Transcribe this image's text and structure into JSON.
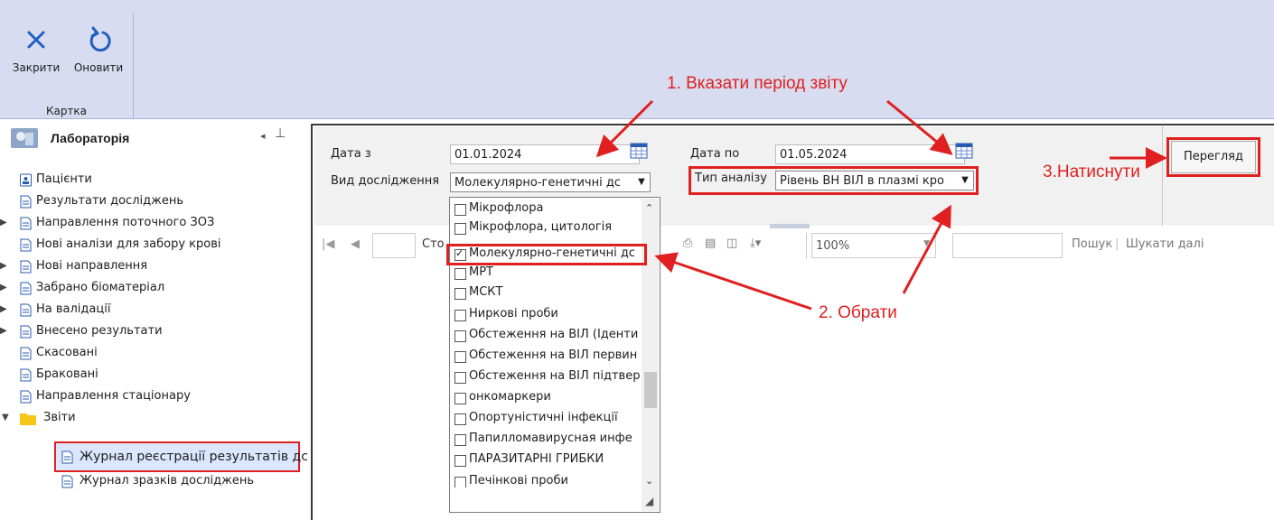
{
  "ribbon": {
    "close_label": "Закрити",
    "refresh_label": "Оновити",
    "group_label": "Картка"
  },
  "sidebar": {
    "title": "Лабораторія",
    "items": [
      {
        "label": "Пацієнти"
      },
      {
        "label": "Результати досліджень"
      },
      {
        "label": "Направлення поточного ЗОЗ"
      },
      {
        "label": "Нові аналізи для забору крові"
      },
      {
        "label": "Нові направлення"
      },
      {
        "label": "Забрано біоматеріал"
      },
      {
        "label": "На валідації"
      },
      {
        "label": "Внесено результати"
      },
      {
        "label": "Скасовані"
      },
      {
        "label": "Браковані"
      },
      {
        "label": "Направлення стаціонару"
      },
      {
        "label": "Звіти"
      },
      {
        "label": "Журнал реєстрації результатів дс"
      },
      {
        "label": "Журнал зразків досліджень"
      }
    ]
  },
  "filters": {
    "date_from_label": "Дата з",
    "date_from_value": "01.01.2024",
    "date_to_label": "Дата по",
    "date_to_value": "01.05.2024",
    "study_type_label": "Вид дослідження",
    "study_type_value": "Молекулярно-генетичні дс",
    "analysis_type_label": "Тип аналізу",
    "analysis_type_value": "Рівень ВН ВІЛ в плазмі кро",
    "view_button": "Перегляд"
  },
  "toolbar": {
    "page_label": "Сто",
    "zoom": "100%",
    "search": "Пошук",
    "search_next": "Шукати далі"
  },
  "dropdown": {
    "items": [
      {
        "label": "Мікрофлора",
        "checked": false
      },
      {
        "label": "Мікрофлора, цитологія",
        "checked": false
      },
      {
        "label": "Молекулярно-генетичні дс",
        "checked": true
      },
      {
        "label": "МРТ",
        "checked": false
      },
      {
        "label": "МСКТ",
        "checked": false
      },
      {
        "label": "Ниркові проби",
        "checked": false
      },
      {
        "label": "Обстеження на ВІЛ (Іденти",
        "checked": false
      },
      {
        "label": "Обстеження на ВІЛ первин",
        "checked": false
      },
      {
        "label": "Обстеження на ВІЛ підтвер",
        "checked": false
      },
      {
        "label": "онкомаркери",
        "checked": false
      },
      {
        "label": "Опортуністичні інфекції",
        "checked": false
      },
      {
        "label": "Папилломавирусная инфе",
        "checked": false
      },
      {
        "label": "ПАРАЗИТАРНІ ГРИБКИ",
        "checked": false
      },
      {
        "label": "Печінкові проби",
        "checked": false
      }
    ]
  },
  "annotations": {
    "step1": "1. Вказати період звіту",
    "step2": "2. Обрати",
    "step3": "3.Натиснути"
  },
  "colors": {
    "ribbon": "#d7dcf0",
    "annotation": "#e02020",
    "selection": "#dbe7ff"
  }
}
